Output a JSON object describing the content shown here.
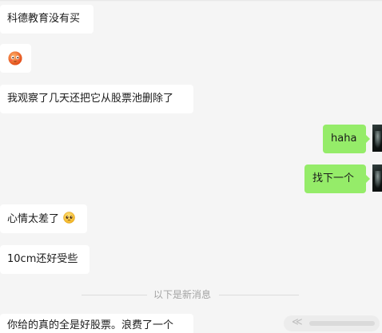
{
  "messages": [
    {
      "side": "in",
      "text": "科德教育没有买"
    },
    {
      "side": "in",
      "emoji": "blushing-face-emoji"
    },
    {
      "side": "in",
      "text": "我观察了几天还把它从股票池删除了"
    },
    {
      "side": "out",
      "text": "haha"
    },
    {
      "side": "out",
      "text": "找下一个"
    },
    {
      "side": "in",
      "text": "心情太差了",
      "emoji": "pleading-face-emoji"
    },
    {
      "side": "in",
      "text": "10cm还好受些"
    },
    {
      "side": "in",
      "text": "你给的真的全是好股票。浪费了一个"
    }
  ],
  "divider": {
    "text": "以下是新消息"
  },
  "colors": {
    "incoming_bubble": "#ffffff",
    "outgoing_bubble": "#95ec69",
    "background": "#f5f5f5",
    "divider_text": "#a3a3a3"
  }
}
